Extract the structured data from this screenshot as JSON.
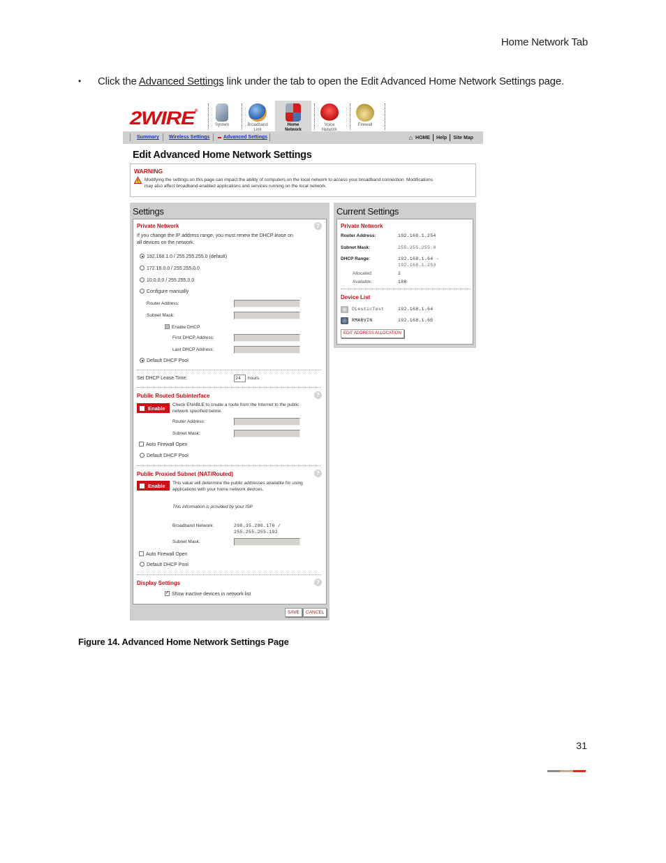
{
  "doc": {
    "running_header": "Home Network Tab",
    "bullet": {
      "before": "Click the ",
      "link": "Advanced Settings",
      "after": " link under the tab to open the Edit Advanced Home Network Settings page."
    },
    "caption": "Figure 14. Advanced Home Network Settings Page",
    "page_number": "31",
    "footer_colors": [
      "#8c8c8c",
      "#c8ad88",
      "#e1261c"
    ]
  },
  "ui": {
    "logo": "2WIRE",
    "logo_mark": "®",
    "tabs": [
      {
        "label1": "System",
        "label2": "",
        "icon": "system-icon",
        "color": "#8a9bb0"
      },
      {
        "label1": "Broadband",
        "label2": "Link",
        "icon": "broadband-globe-icon",
        "color": "#e8a23a"
      },
      {
        "label1": "Home",
        "label2": "Network",
        "icon": "home-network-icon",
        "color": "#4f6fa8",
        "active": true
      },
      {
        "label1": "Voice",
        "label2": "Network",
        "icon": "phone-icon",
        "color": "#d21e1e"
      },
      {
        "label1": "Firewall",
        "label2": "",
        "icon": "padlock-icon",
        "color": "#c8a94a"
      }
    ],
    "subnav": {
      "links": [
        "Summary",
        "Wireless Settings",
        "Advanced Settings"
      ],
      "right": [
        "HOME",
        "Help",
        "Site Map"
      ]
    },
    "page_title": "Edit Advanced Home Network Settings",
    "warning": {
      "title": "WARNING",
      "line1": "Modifying the settings on this page can impact the ability of computers on the local network to access your broadband connection. Modifications",
      "line2": "may also affect broadband-enabled applications and services running on the local network."
    },
    "settings": {
      "title": "Settings",
      "private_network": {
        "heading": "Private Network",
        "note1": "If you change the IP address range, you must renew the DHCP lease on",
        "note2": "all devices on the network.",
        "options": [
          {
            "label": "192.168.1.0 / 255.255.255.0 (default)",
            "selected": true
          },
          {
            "label": "172.16.0.0 / 255.255.0.0",
            "selected": false
          },
          {
            "label": "10.0.0.0 / 255.255.0.0",
            "selected": false
          },
          {
            "label": "Configure manually",
            "selected": false
          }
        ],
        "router_address_label": "Router Address:",
        "subnet_mask_label": "Subnet Mask:",
        "enable_dhcp_label": "Enable DHCP",
        "first_dhcp_label": "First DHCP Address:",
        "last_dhcp_label": "Last DHCP Address:",
        "default_pool_label": "Default DHCP Pool"
      },
      "lease": {
        "label": "Set DHCP Lease Time:",
        "value": "24",
        "unit": "hours"
      },
      "routed": {
        "heading": "Public Routed Subinterface",
        "enable_label": "Enable",
        "desc1": "Check ENABLE to create a route from the Internet to the public",
        "desc2": "network specified below.",
        "router_address_label": "Router Address:",
        "subnet_mask_label": "Subnet Mask:",
        "auto_firewall_label": "Auto Firewall Open",
        "default_pool_label": "Default DHCP Pool"
      },
      "proxied": {
        "heading": "Public Proxied Subnet (NAT/Routed)",
        "enable_label": "Enable",
        "desc1": "This value will determine the public addresses available for using",
        "desc2": "applications with your home network devices.",
        "isp_note": "This information is provided by your ISP",
        "broadband_label": "Broadband Network:",
        "broadband_value1": "208.35.280.176 /",
        "broadband_value2": "255.255.255.192",
        "subnet_mask_label": "Subnet Mask:",
        "auto_firewall_label": "Auto Firewall Open",
        "default_pool_label": "Default DHCP Pool"
      },
      "display": {
        "heading": "Display Settings",
        "show_inactive_label": "Show inactive devices in network list",
        "show_inactive_checked": true
      },
      "save_label": "SAVE",
      "cancel_label": "CANCEL"
    },
    "current": {
      "title": "Current Settings",
      "heading": "Private Network",
      "router_label": "Router Address:",
      "router_value": "192.168.1.254",
      "mask_label": "Subnet Mask:",
      "mask_value": "255.255.255.0",
      "dhcp_label": "DHCP Range:",
      "dhcp_value1": "192.168.1.64 -",
      "dhcp_value2": "192.168.1.253",
      "allocated_label": "Allocated:",
      "allocated_value": "2",
      "available_label": "Available:",
      "available_value": "188",
      "device_heading": "Device List",
      "devices": [
        {
          "name": "DLesticTest",
          "ip": "192.168.1.64",
          "active": false
        },
        {
          "name": "RMARVIN",
          "ip": "192.168.1.65",
          "active": true
        }
      ],
      "edit_button": "EDIT ADDRESS ALLOCATION"
    }
  }
}
